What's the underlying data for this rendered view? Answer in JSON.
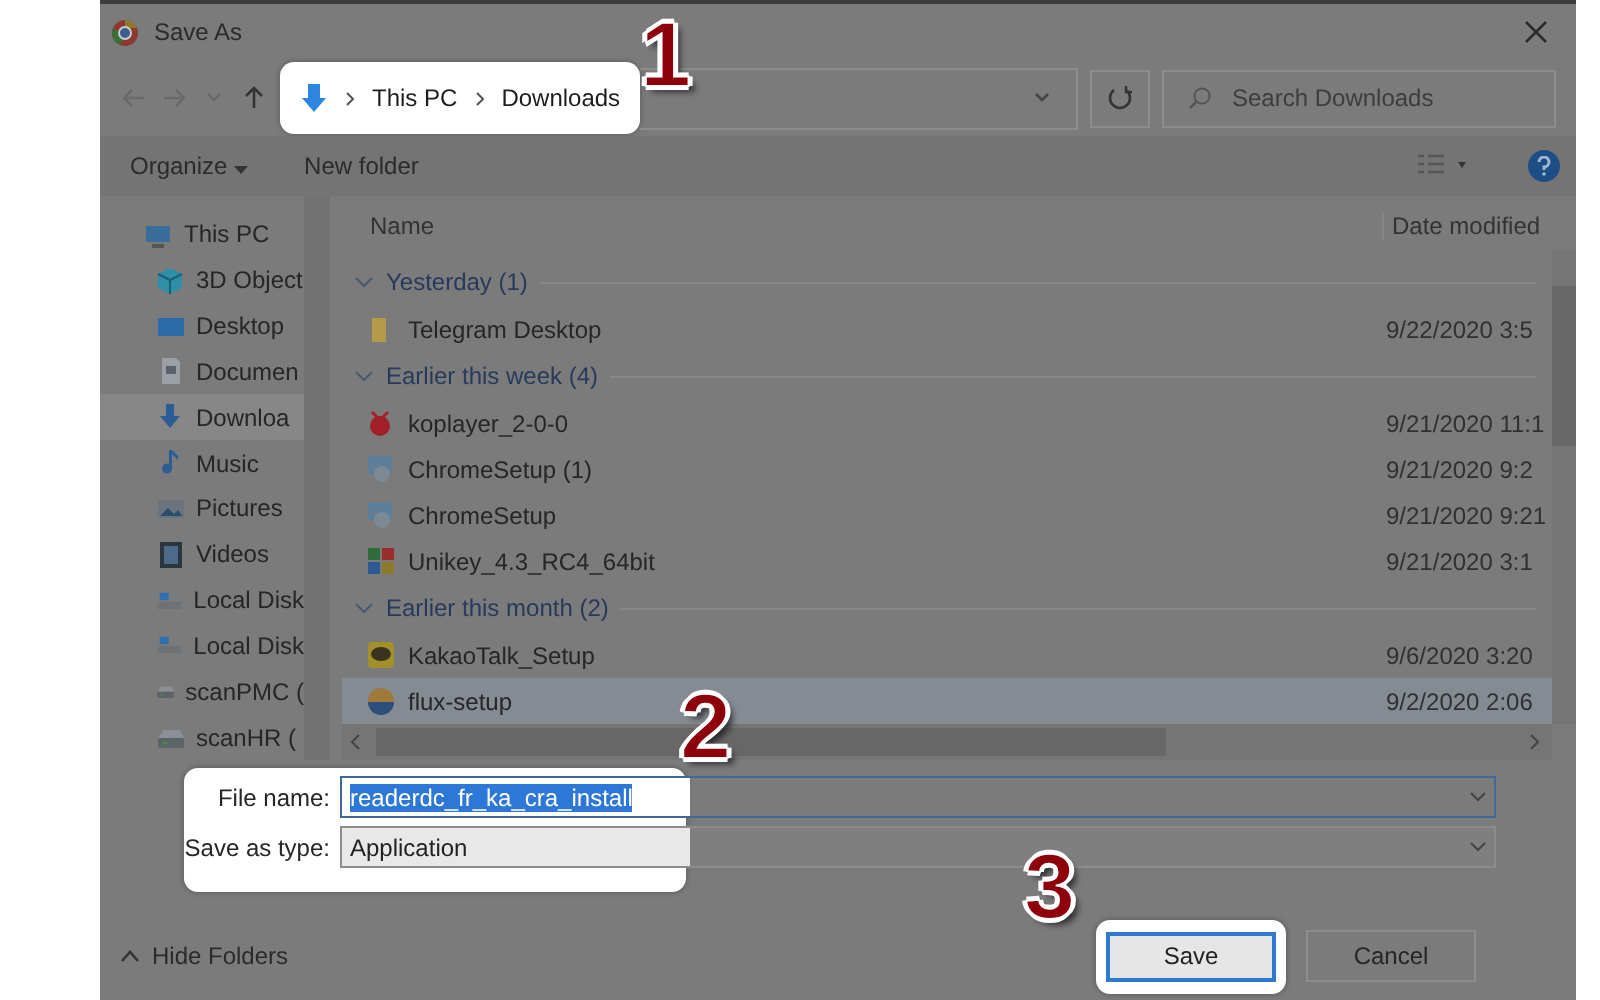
{
  "window": {
    "title": "Save As"
  },
  "address": {
    "breadcrumb": [
      "This PC",
      "Downloads"
    ]
  },
  "search": {
    "placeholder": "Search Downloads"
  },
  "toolbar": {
    "organize": "Organize",
    "new_folder": "New folder"
  },
  "sidebar": {
    "items": [
      {
        "label": "This PC",
        "kind": "pc",
        "selected": false
      },
      {
        "label": "3D Object",
        "kind": "cube",
        "selected": false
      },
      {
        "label": "Desktop",
        "kind": "desktop",
        "selected": false
      },
      {
        "label": "Documen",
        "kind": "document",
        "selected": false
      },
      {
        "label": "Downloa",
        "kind": "download",
        "selected": true
      },
      {
        "label": "Music",
        "kind": "music",
        "selected": false
      },
      {
        "label": "Pictures",
        "kind": "pictures",
        "selected": false
      },
      {
        "label": "Videos",
        "kind": "videos",
        "selected": false
      },
      {
        "label": "Local Disk",
        "kind": "disk",
        "selected": false
      },
      {
        "label": "Local Disk",
        "kind": "disk",
        "selected": false
      },
      {
        "label": "scanPMC (",
        "kind": "drive",
        "selected": false
      },
      {
        "label": "scanHR (",
        "kind": "drive",
        "selected": false
      }
    ]
  },
  "file_list": {
    "columns": [
      "Name",
      "Date modified"
    ],
    "groups": [
      {
        "title": "Yesterday (1)",
        "expanded": true,
        "items": [
          {
            "name": "Telegram Desktop",
            "kind": "folder",
            "date": "9/22/2020 3:5",
            "selected": false
          }
        ]
      },
      {
        "title": "Earlier this week (4)",
        "expanded": true,
        "items": [
          {
            "name": "koplayer_2-0-0",
            "kind": "bug",
            "date": "9/21/2020 11:1",
            "selected": false
          },
          {
            "name": "ChromeSetup (1)",
            "kind": "setup",
            "date": "9/21/2020 9:2",
            "selected": false
          },
          {
            "name": "ChromeSetup",
            "kind": "setup",
            "date": "9/21/2020 9:21",
            "selected": false
          },
          {
            "name": "Unikey_4.3_RC4_64bit",
            "kind": "tiles",
            "date": "9/21/2020 3:1",
            "selected": false
          }
        ]
      },
      {
        "title": "Earlier this month (2)",
        "expanded": true,
        "items": [
          {
            "name": "KakaoTalk_Setup",
            "kind": "chat",
            "date": "9/6/2020 3:20",
            "selected": false
          },
          {
            "name": "flux-setup",
            "kind": "disc",
            "date": "9/2/2020 2:06",
            "selected": true
          }
        ]
      }
    ]
  },
  "form": {
    "file_name_label": "File name:",
    "file_name": "readerdc_fr_ka_cra_install",
    "type_label": "Save as type:",
    "type": "Application"
  },
  "footer": {
    "hide_folders": "Hide Folders",
    "save": "Save",
    "cancel": "Cancel"
  },
  "callouts": [
    "1",
    "2",
    "3"
  ]
}
